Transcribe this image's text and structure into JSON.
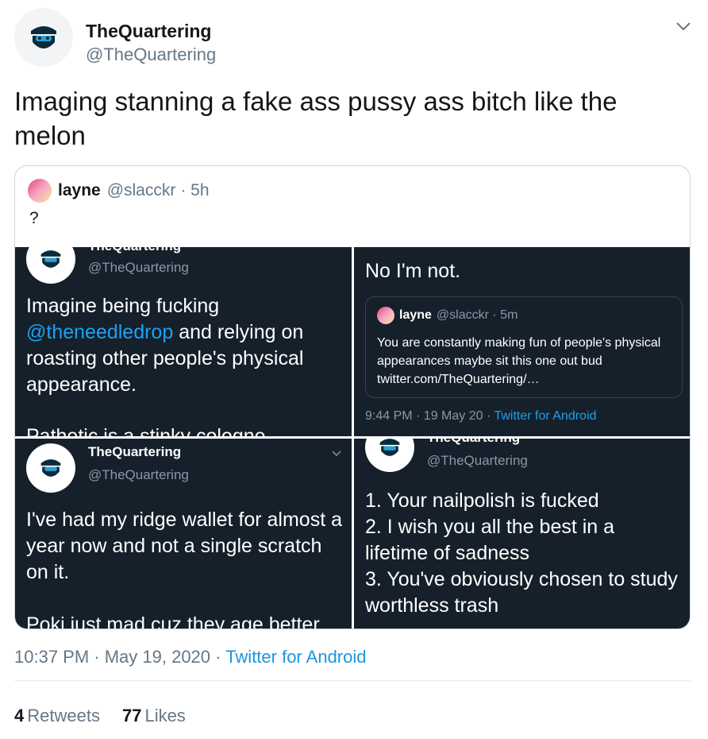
{
  "author": {
    "name": "TheQuartering",
    "handle": "@TheQuartering"
  },
  "tweet": {
    "text": "Imaging stanning a fake ass pussy ass bitch like the melon"
  },
  "quote": {
    "name": "layne",
    "handle": "@slacckr",
    "time": "· 5h",
    "text": "?"
  },
  "screens": {
    "top_left": {
      "handle": "@TheQuartering",
      "cut_name": "TheQuartering",
      "text_a": "Imagine being fucking ",
      "mention": "@theneedledrop",
      "text_b": " and relying on roasting other people's physical appearance.",
      "cut_text": "Pathetic is a stinky cologne"
    },
    "top_right": {
      "text": "No I'm not.",
      "nested_name": "layne",
      "nested_handle": "@slacckr · 5m",
      "nested_text": "You are constantly making fun of people's physical appearances maybe sit this one out bud twitter.com/TheQuartering/…",
      "meta_time": "9:44 PM · 19 May 20 ·",
      "meta_source": "Twitter for Android"
    },
    "bottom_left": {
      "name": "TheQuartering",
      "handle": "@TheQuartering",
      "text": "I've had my ridge wallet for almost a year now and not a single scratch on it.",
      "text_2": "Poki just mad cuz they age better"
    },
    "bottom_right": {
      "cut_name": "TheQuartering",
      "handle": "@TheQuartering",
      "text": "1. Your nailpolish is fucked\n2. I wish you all the best in a lifetime of sadness\n3. You've obviously chosen to study worthless trash"
    }
  },
  "meta": {
    "time": "10:37 PM · May 19, 2020 ·",
    "source": "Twitter for Android"
  },
  "stats": {
    "retweets_count": "4",
    "retweets_label": "Retweets",
    "likes_count": "77",
    "likes_label": "Likes"
  },
  "colors": {
    "link": "#1b95e0",
    "dark_bg": "#15202b"
  }
}
